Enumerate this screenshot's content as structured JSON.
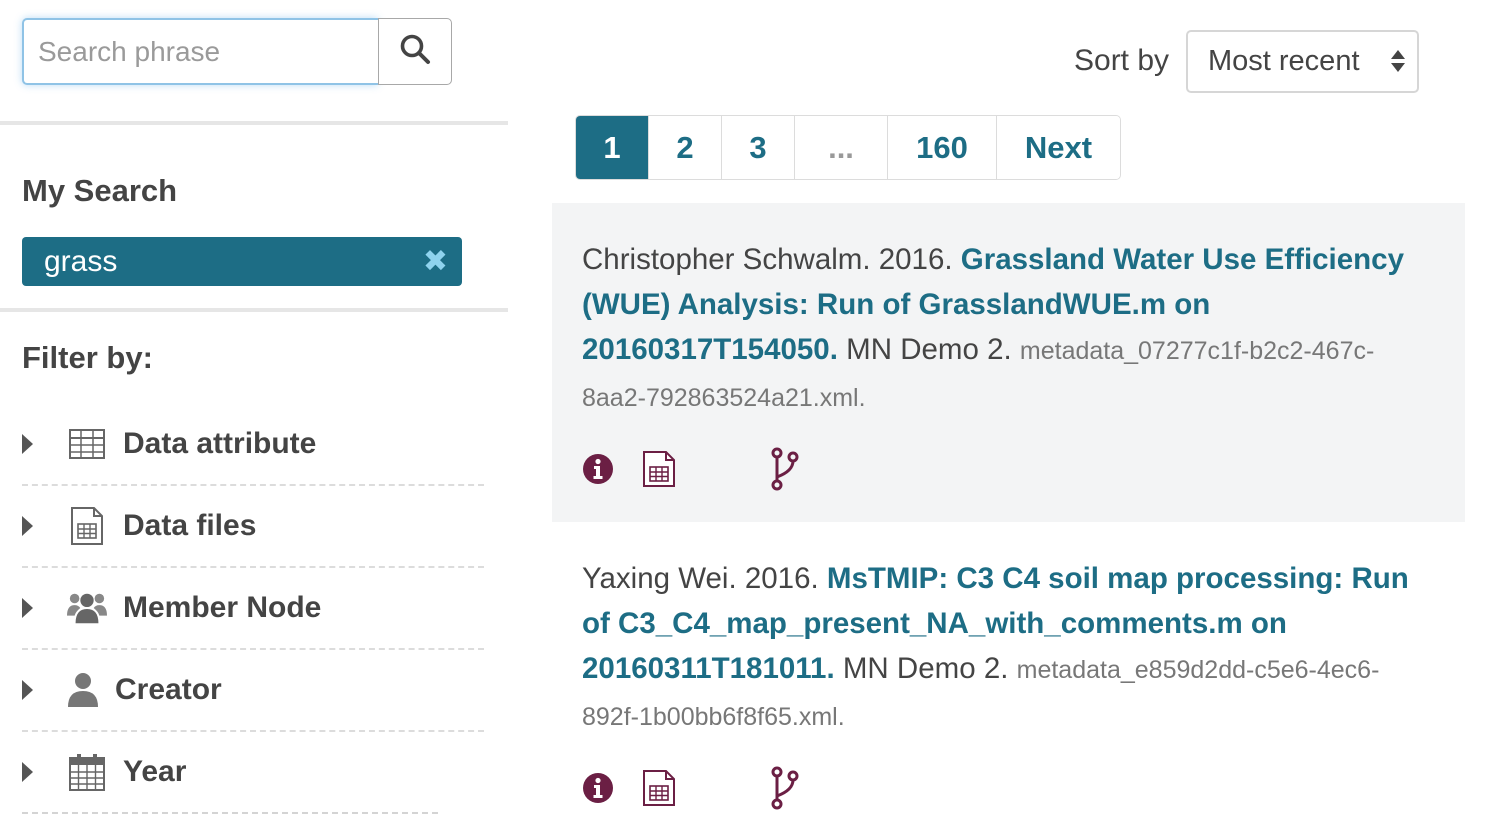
{
  "search": {
    "placeholder": "Search phrase",
    "value": ""
  },
  "my_search": {
    "title": "My Search",
    "tags": [
      {
        "label": "grass",
        "remove": "✖"
      }
    ]
  },
  "filters": {
    "title": "Filter by:",
    "items": [
      {
        "label": "Data attribute",
        "icon": "table-icon"
      },
      {
        "label": "Data files",
        "icon": "file-table-icon"
      },
      {
        "label": "Member Node",
        "icon": "users-icon"
      },
      {
        "label": "Creator",
        "icon": "user-icon"
      },
      {
        "label": "Year",
        "icon": "calendar-icon"
      }
    ]
  },
  "sort": {
    "label": "Sort by",
    "selected": "Most recent"
  },
  "pagination": {
    "pages": [
      "1",
      "2",
      "3",
      "...",
      "160"
    ],
    "next": "Next",
    "active": "1"
  },
  "results": [
    {
      "author_year": "Christopher Schwalm. 2016. ",
      "title": "Grassland Water Use Efficiency (WUE) Analysis: Run of GrasslandWUE.m on 20160317T154050.",
      "node": " MN Demo 2. ",
      "id": "metadata_07277c1f-b2c2-467c-8aa2-792863524a21.xml."
    },
    {
      "author_year": "Yaxing Wei. 2016. ",
      "title": "MsTMIP: C3 C4 soil map processing: Run of C3_C4_map_present_NA_with_comments.m on 20160311T181011.",
      "node": " MN Demo 2. ",
      "id": "metadata_e859d2dd-c5e6-4ec6-892f-1b00bb6f8f65.xml."
    }
  ],
  "colors": {
    "accent": "#1d6d85",
    "icon": "#6b1f44",
    "shade": "#f3f4f5"
  }
}
